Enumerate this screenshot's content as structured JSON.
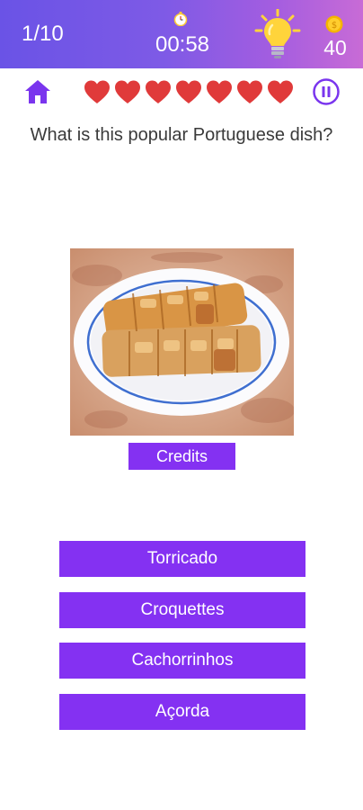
{
  "header": {
    "progress": "1/10",
    "timer": "00:58",
    "coins": "40"
  },
  "hud": {
    "lives": 7,
    "home_icon": "home-icon",
    "pause_icon": "pause-icon"
  },
  "question": "What is this popular Portuguese dish?",
  "credits_label": "Credits",
  "answers": [
    "Torricado",
    "Croquettes",
    "Cachorrinhos",
    "Açorda"
  ],
  "colors": {
    "accent": "#8431f2",
    "heart": "#e03a3a",
    "header_gradient_start": "#6a53e6",
    "header_gradient_end": "#c86bd6",
    "bulb": "#ffd43b"
  }
}
